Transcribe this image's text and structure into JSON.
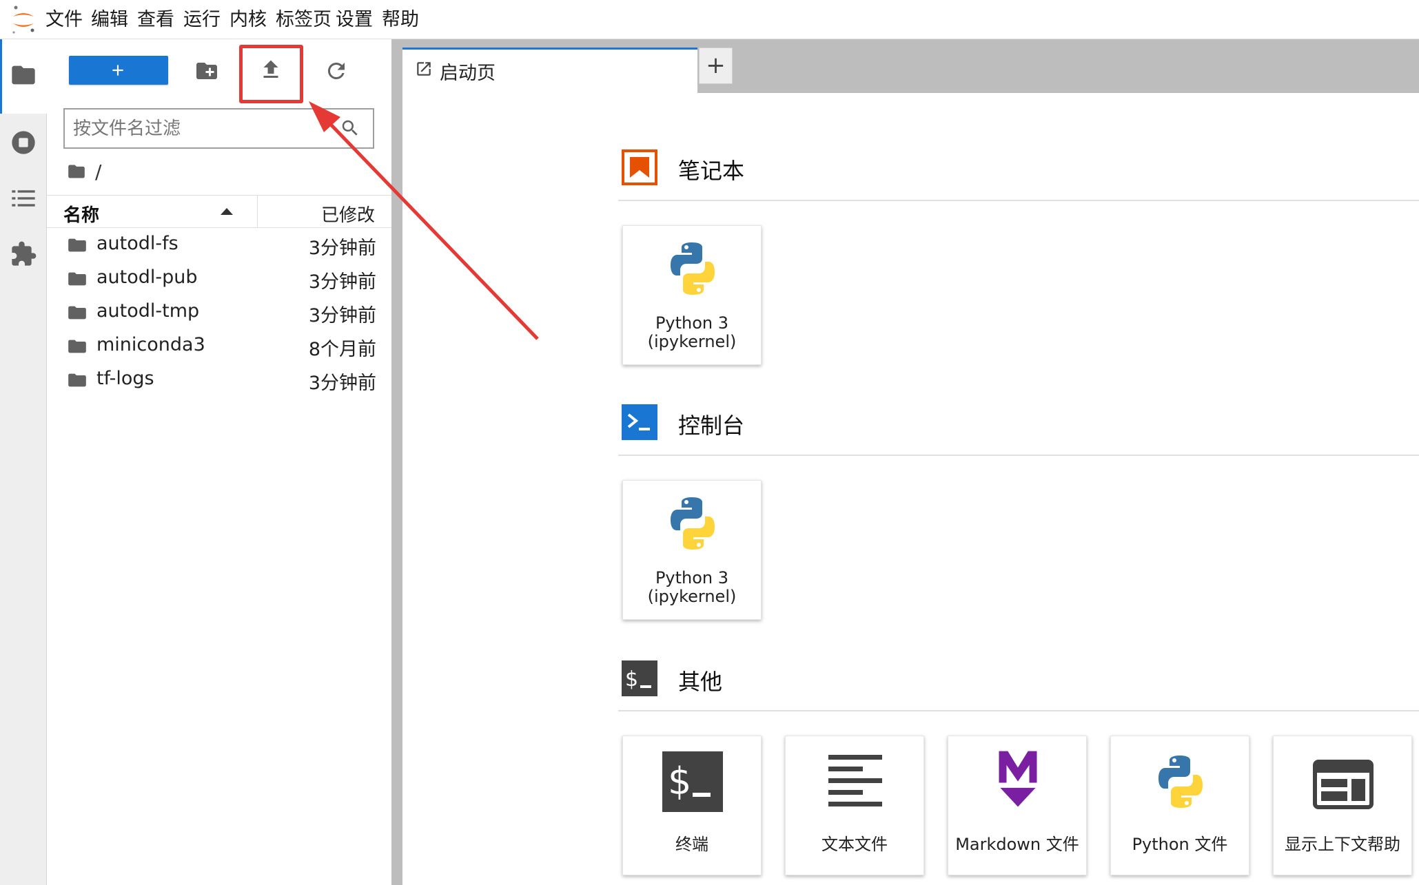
{
  "menubar": {
    "items": [
      "文件",
      "编辑",
      "查看",
      "运行",
      "内核",
      "标签页",
      "设置",
      "帮助"
    ]
  },
  "filebrowser": {
    "new_button_label": "+",
    "filter_placeholder": "按文件名过滤",
    "breadcrumb": "/",
    "columns": {
      "name": "名称",
      "modified": "已修改"
    },
    "files": [
      {
        "name": "autodl-fs",
        "modified": "3分钟前"
      },
      {
        "name": "autodl-pub",
        "modified": "3分钟前"
      },
      {
        "name": "autodl-tmp",
        "modified": "3分钟前"
      },
      {
        "name": "miniconda3",
        "modified": "8个月前"
      },
      {
        "name": "tf-logs",
        "modified": "3分钟前"
      }
    ]
  },
  "tabs": {
    "launcher_label": "启动页",
    "add_label": "+"
  },
  "launcher": {
    "notebook": {
      "title": "笔记本",
      "card": {
        "line1": "Python 3",
        "line2": "(ipykernel)"
      }
    },
    "console": {
      "title": "控制台",
      "card": {
        "line1": "Python 3",
        "line2": "(ipykernel)"
      }
    },
    "other": {
      "title": "其他",
      "cards": [
        "终端",
        "文本文件",
        "Markdown 文件",
        "Python 文件",
        "显示上下文帮助"
      ]
    }
  },
  "colors": {
    "accent": "#1976d2",
    "highlight": "#e53935",
    "notebook_icon": "#e65100",
    "markdown_icon": "#7b1fa2"
  },
  "icons": {
    "toolbar": [
      "new-folder-icon",
      "upload-icon",
      "refresh-icon"
    ],
    "activity": [
      "folder-icon",
      "stop-circle-icon",
      "list-icon",
      "puzzle-icon"
    ]
  }
}
